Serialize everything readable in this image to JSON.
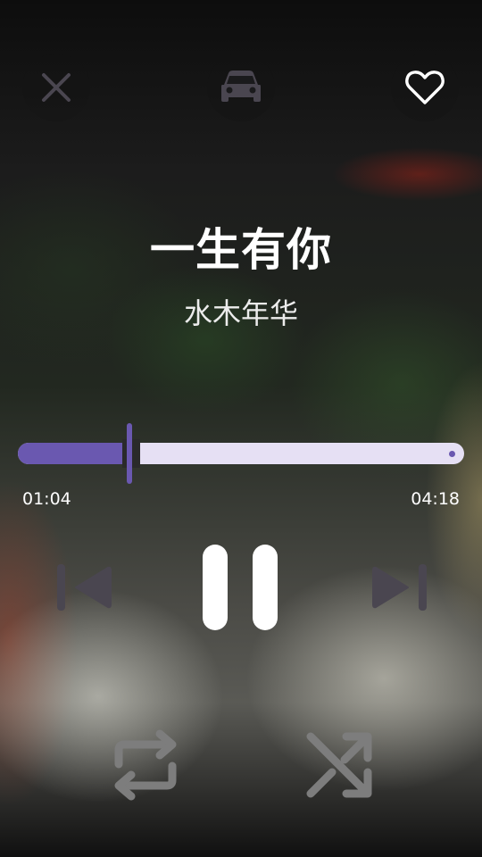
{
  "top_bar": {
    "close_icon": "close-icon",
    "car_icon": "car-mode-icon",
    "favorite_icon": "heart-outline-icon"
  },
  "track": {
    "title": "一生有你",
    "artist": "水木年华"
  },
  "progress": {
    "current_time": "01:04",
    "total_time": "04:18",
    "fraction": 0.25,
    "played_color": "#6a58b0",
    "remaining_color": "#e6e0f4"
  },
  "controls": {
    "previous_icon": "skip-previous-icon",
    "play_pause_icon": "pause-icon",
    "next_icon": "skip-next-icon",
    "repeat_icon": "repeat-icon",
    "shuffle_icon": "shuffle-icon"
  },
  "colors": {
    "accent": "#6a58b0",
    "icon_dark": "#4a4650",
    "icon_gray": "#7d7d7d"
  }
}
